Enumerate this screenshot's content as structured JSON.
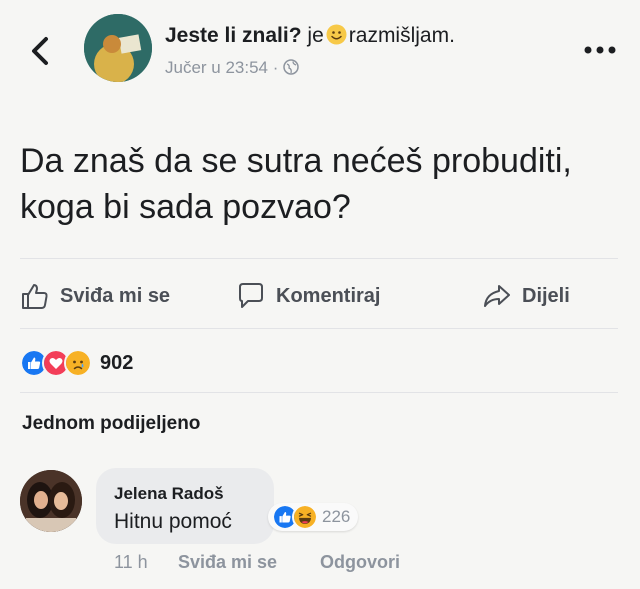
{
  "header": {
    "page_name": "Jeste li znali?",
    "feeling_prefix": "je",
    "feeling_icon": "smiley-emoji",
    "feeling_text": "razmišljam.",
    "timestamp": "Jučer u 23:54 ·",
    "privacy_icon": "globe-icon"
  },
  "post": {
    "text": "Da znaš da se sutra nećeš probuditi, koga bi sada pozvao?"
  },
  "actions": {
    "like": "Sviđa mi se",
    "comment": "Komentiraj",
    "share": "Dijeli"
  },
  "reactions": {
    "icons": [
      "like",
      "love",
      "sad"
    ],
    "count": "902"
  },
  "shares": {
    "text": "Jednom podijeljeno"
  },
  "comment": {
    "author": "Jelena Radoš",
    "text": "Hitnu pomoć",
    "reaction_icons": [
      "like",
      "haha"
    ],
    "reaction_count": "226",
    "time": "11 h",
    "like_label": "Sviđa mi se",
    "reply_label": "Odgovori"
  },
  "colors": {
    "background": "#f6f6f4",
    "like_blue": "#1877f2",
    "love_red": "#f33e58",
    "emoji_yellow": "#f7b125",
    "muted_gray": "#8d949e"
  }
}
